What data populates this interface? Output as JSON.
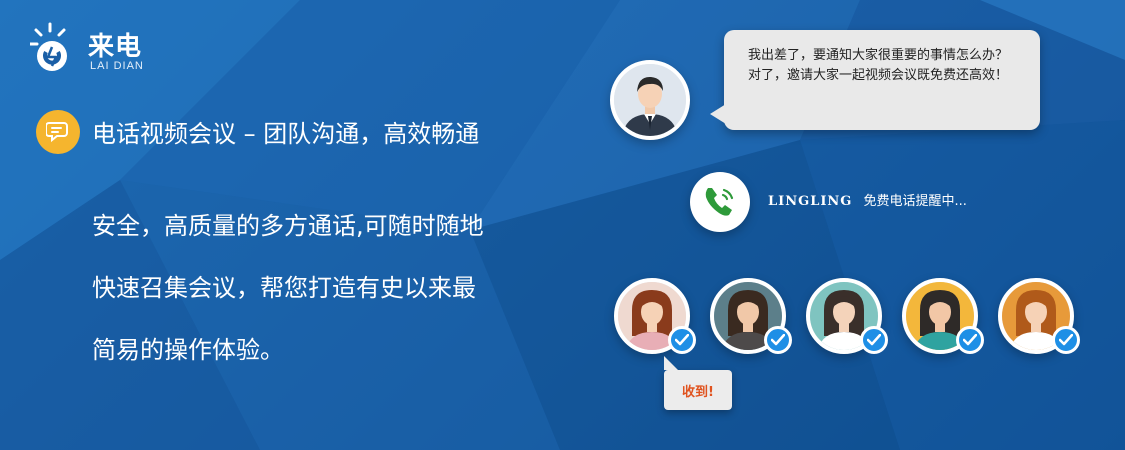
{
  "logo": {
    "name": "来电",
    "sub": "LAI DIAN"
  },
  "headline": {
    "text": "电话视频会议 – 团队沟通，高效畅通",
    "icon": "chat-bubble-icon"
  },
  "body_copy": {
    "lines": [
      "安全，高质量的多方通话,可随时随地",
      "快速召集会议，帮您打造有史以来最",
      "简易的操作体验。"
    ]
  },
  "chat": {
    "bubble_text": "我出差了，要通知大家很重要的事情怎么办？对了，邀请大家一起视频会议既免费还高效！",
    "status_name": "LINGLING",
    "status_text": "免费电话提醒中...",
    "reply": "收到!",
    "participants": [
      {
        "id": "woman-red-hair",
        "hair": "#8a3b1c",
        "skin": "#f6d2b6",
        "shirt": "#e8aeb6",
        "bg": "#efd9d0"
      },
      {
        "id": "man-beard",
        "hair": "#3a2a20",
        "skin": "#f1c8a8",
        "shirt": "#4d4a4a",
        "bg": "#5c7f8a"
      },
      {
        "id": "woman-teal",
        "hair": "#3a2f2a",
        "skin": "#f4d3ba",
        "shirt": "#ffffff",
        "bg": "#7fc4c0"
      },
      {
        "id": "woman-yellow",
        "hair": "#2e2a28",
        "skin": "#f2c7a6",
        "shirt": "#2fa3a0",
        "bg": "#f3b73b"
      },
      {
        "id": "woman-orange",
        "hair": "#b05a1a",
        "skin": "#f6d2b6",
        "shirt": "#ffffff",
        "bg": "#e79a3a"
      }
    ]
  },
  "colors": {
    "background": "#1a5fa6",
    "accent_yellow": "#f5b52e",
    "check_blue": "#1e8fe6",
    "phone_green": "#2e9a3a",
    "reply_orange": "#e0531f"
  }
}
